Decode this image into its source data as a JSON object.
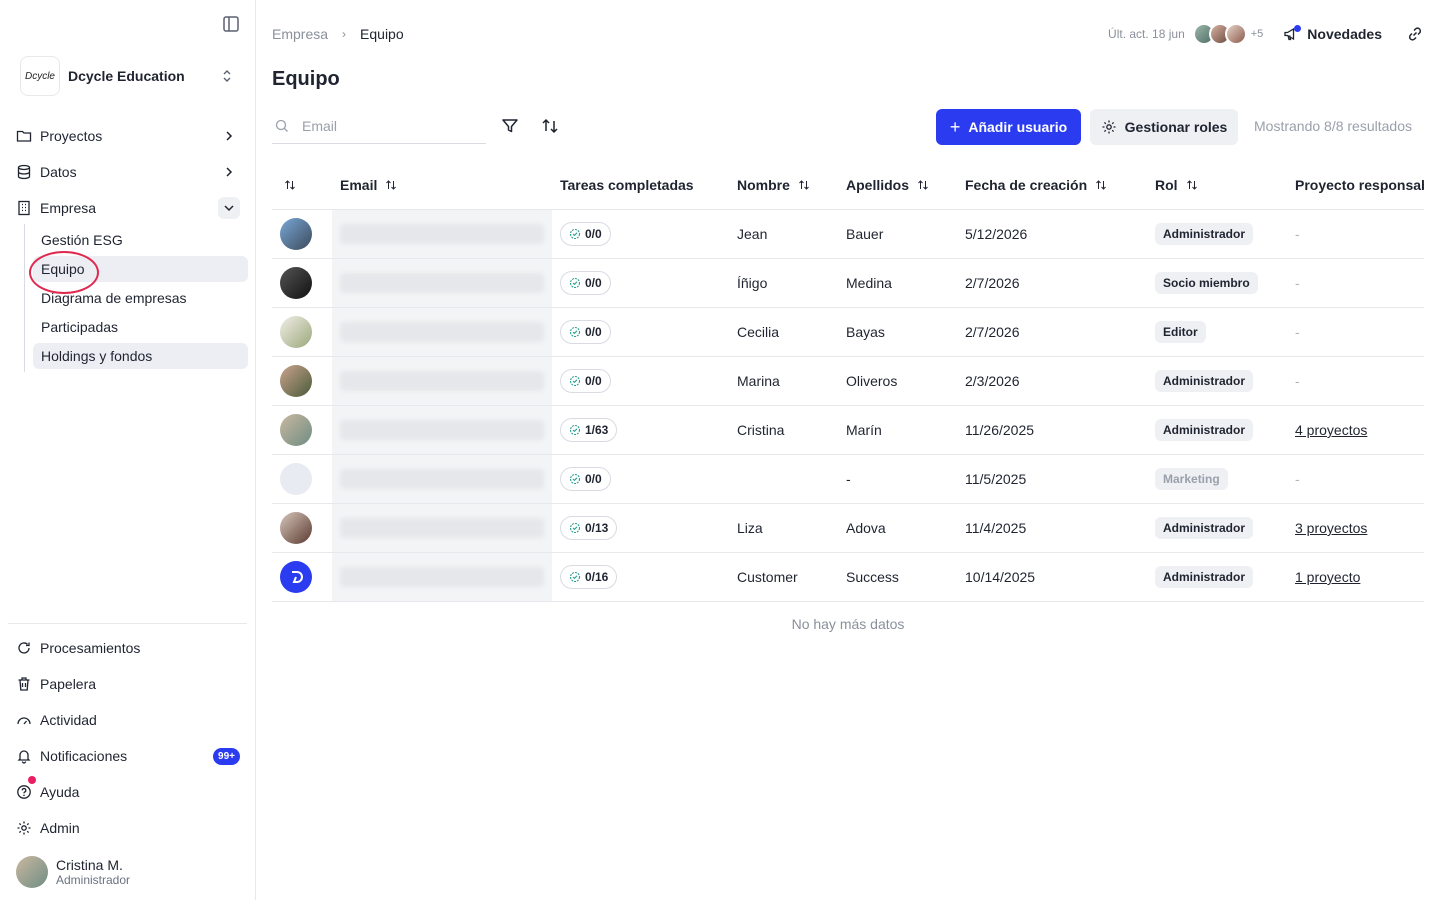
{
  "sidebar": {
    "org_logo_text": "Dcycle",
    "org_name": "Dcycle Education",
    "nav": [
      {
        "label": "Proyectos"
      },
      {
        "label": "Datos"
      },
      {
        "label": "Empresa"
      }
    ],
    "subnav": [
      {
        "label": "Gestión ESG"
      },
      {
        "label": "Equipo"
      },
      {
        "label": "Diagrama de empresas"
      },
      {
        "label": "Participadas"
      },
      {
        "label": "Holdings y fondos"
      }
    ],
    "bottom": [
      {
        "label": "Procesamientos"
      },
      {
        "label": "Papelera"
      },
      {
        "label": "Actividad"
      },
      {
        "label": "Notificaciones",
        "badge": "99+"
      },
      {
        "label": "Ayuda"
      },
      {
        "label": "Admin"
      }
    ],
    "user": {
      "name": "Cristina M.",
      "role": "Administrador"
    }
  },
  "header": {
    "breadcrumb": [
      "Empresa",
      "Equipo"
    ],
    "last_update": "Últ. act. 18 jun",
    "avatars_more": "+5",
    "news_label": "Novedades"
  },
  "page": {
    "title": "Equipo",
    "search_placeholder": "Email",
    "add_button": "Añadir usuario",
    "roles_button": "Gestionar roles",
    "results": "Mostrando 8/8 resultados",
    "no_more": "No hay más datos"
  },
  "table": {
    "columns": {
      "email": "Email",
      "tasks": "Tareas completadas",
      "nombre": "Nombre",
      "apellidos": "Apellidos",
      "fecha": "Fecha de creación",
      "rol": "Rol",
      "proyecto": "Proyecto responsab"
    },
    "rows": [
      {
        "email": "jean.bauer@dcycle.io",
        "tasks": "0/0",
        "nombre": "Jean",
        "apellidos": "Bauer",
        "fecha": "5/12/2026",
        "rol": "Administrador",
        "proyecto": "-"
      },
      {
        "email": "inigo.medina@dcycle.io",
        "tasks": "0/0",
        "nombre": "Íñigo",
        "apellidos": "Medina",
        "fecha": "2/7/2026",
        "rol": "Socio miembro",
        "proyecto": "-"
      },
      {
        "email": "cecilia.bayas@dcycle.io",
        "tasks": "0/0",
        "nombre": "Cecilia",
        "apellidos": "Bayas",
        "fecha": "2/7/2026",
        "rol": "Editor",
        "proyecto": "-"
      },
      {
        "email": "marina.oliveros@dcycle.io",
        "tasks": "0/0",
        "nombre": "Marina",
        "apellidos": "Oliveros",
        "fecha": "2/3/2026",
        "rol": "Administrador",
        "proyecto": "-"
      },
      {
        "email": "cristina.marin@dcycle.io",
        "tasks": "1/63",
        "nombre": "Cristina",
        "apellidos": "Marín",
        "fecha": "11/26/2025",
        "rol": "Administrador",
        "proyecto": "4 proyectos"
      },
      {
        "email": "teammate@name.com",
        "tasks": "0/0",
        "nombre": "",
        "apellidos": "-",
        "fecha": "11/5/2025",
        "rol": "Marketing",
        "proyecto": "-"
      },
      {
        "email": "liza.adova@dcycle.io",
        "tasks": "0/13",
        "nombre": "Liza",
        "apellidos": "Adova",
        "fecha": "11/4/2025",
        "rol": "Administrador",
        "proyecto": "3 proyectos"
      },
      {
        "email": "clients@dcycle.io",
        "tasks": "0/16",
        "nombre": "Customer",
        "apellidos": "Success",
        "fecha": "10/14/2025",
        "rol": "Administrador",
        "proyecto": "1 proyecto"
      }
    ]
  },
  "colors": {
    "accent": "#2b3cf0",
    "highlight_circle": "#e0294f"
  }
}
